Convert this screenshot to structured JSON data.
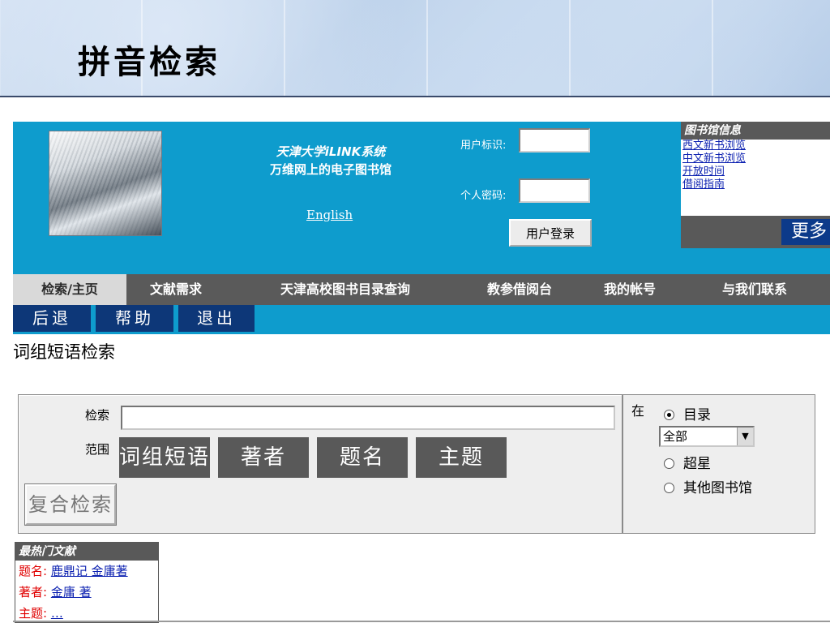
{
  "slide": {
    "title": "拼音检索"
  },
  "top_panel": {
    "system_name_line1": "天津大学iLINK系统",
    "system_name_line2": "万维网上的电子图书馆",
    "english_link": "English",
    "user_id_label": "用户标识:",
    "password_label": "个人密码:",
    "login_button": "用户登录",
    "library_info": {
      "title": "图书馆信息",
      "links": [
        "西文新书浏览",
        "中文新书浏览",
        "开放时间",
        "借阅指南"
      ],
      "more": "更多"
    }
  },
  "nav": {
    "tabs": [
      "检索/主页",
      "文献需求",
      "天津高校图书目录查询",
      "教参借阅台",
      "我的帐号",
      "与我们联系"
    ],
    "active_tab": "检索/主页"
  },
  "sub_nav": {
    "buttons": [
      "后退",
      "帮助",
      "退出"
    ]
  },
  "section_title": "词组短语检索",
  "search_form": {
    "search_label": "检索",
    "search_value": "",
    "scope_label": "范围",
    "scope_buttons": [
      "词组短语",
      "著者",
      "题名",
      "主题"
    ],
    "complex_search": "复合检索"
  },
  "options": {
    "in_label": "在",
    "catalog": "目录",
    "catalog_selected": true,
    "select_value": "全部",
    "superstar": "超星",
    "other_libraries": "其他图书馆"
  },
  "hot_docs": {
    "title": "最热门文献",
    "rows": [
      {
        "key": "题名:",
        "value": "鹿鼎记 金庸著"
      },
      {
        "key": "著者:",
        "value": "金庸 著"
      },
      {
        "key": "主题:",
        "value": "…"
      }
    ]
  },
  "colors": {
    "panel_blue": "#0e9ccd",
    "nav_gray": "#5a5a5a",
    "sub_navy": "#0d3778",
    "link_blue": "#0a1fb0",
    "label_red": "#e00000"
  }
}
